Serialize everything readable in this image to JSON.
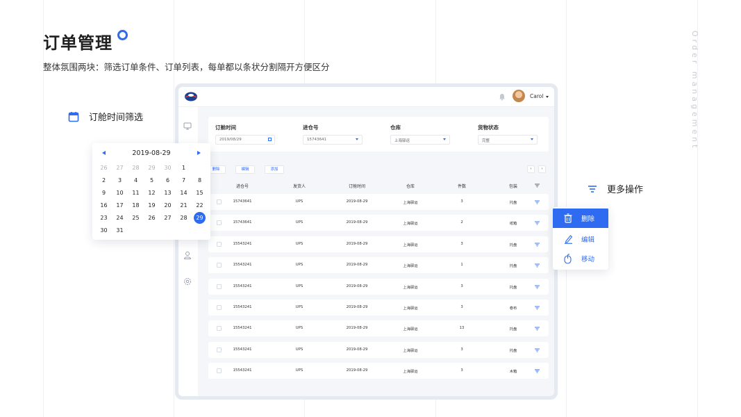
{
  "page": {
    "title": "订单管理",
    "subtitle": "整体氛围两块：筛选订单条件、订单列表，每单都以条状分割隔开方便区分",
    "vertical_label": "Order management"
  },
  "features": {
    "filter_label": "订舱时间筛选",
    "more_label": "更多操作"
  },
  "app": {
    "user": {
      "name": "Carol"
    },
    "filters": [
      {
        "label": "订舱时间",
        "value": "2019/08/29",
        "control": "date"
      },
      {
        "label": "进仓号",
        "value": "15743641",
        "control": "select"
      },
      {
        "label": "仓库",
        "value": "上海驿运",
        "control": "select"
      },
      {
        "label": "货物状态",
        "value": "完整",
        "control": "select"
      }
    ],
    "actions": {
      "delete": "删除",
      "edit": "编辑",
      "add": "添加"
    },
    "pager": {
      "prev": "‹",
      "next": "›"
    },
    "table": {
      "columns": [
        "进仓号",
        "发货人",
        "订舱时间",
        "仓库",
        "件数",
        "包装"
      ],
      "rows": [
        [
          "15743641",
          "UPS",
          "2019-08-29",
          "上海驿运",
          "3",
          "托盘"
        ],
        [
          "15743641",
          "UPS",
          "2019-08-29",
          "上海驿运",
          "2",
          "纸箱"
        ],
        [
          "15543241",
          "UPS",
          "2019-08-29",
          "上海驿运",
          "3",
          "托盘"
        ],
        [
          "15543241",
          "UPS",
          "2019-08-29",
          "上海驿运",
          "1",
          "托盘"
        ],
        [
          "15543241",
          "UPS",
          "2019-08-29",
          "上海驿运",
          "3",
          "托盘"
        ],
        [
          "15543241",
          "UPS",
          "2019-08-29",
          "上海驿运",
          "3",
          "卷布"
        ],
        [
          "15543241",
          "UPS",
          "2019-08-29",
          "上海驿运",
          "13",
          "托盘"
        ],
        [
          "15543241",
          "UPS",
          "2019-08-29",
          "上海驿运",
          "3",
          "托盘"
        ],
        [
          "15543241",
          "UPS",
          "2019-08-29",
          "上海驿运",
          "3",
          "木箱"
        ]
      ]
    }
  },
  "calendar": {
    "title": "2019-08-29",
    "days": [
      {
        "d": "26",
        "muted": true
      },
      {
        "d": "27",
        "muted": true
      },
      {
        "d": "28",
        "muted": true
      },
      {
        "d": "29",
        "muted": true
      },
      {
        "d": "30",
        "muted": true
      },
      {
        "d": "1"
      },
      {
        "d": "",
        "muted": true
      },
      {
        "d": "2"
      },
      {
        "d": "3"
      },
      {
        "d": "4"
      },
      {
        "d": "5"
      },
      {
        "d": "6"
      },
      {
        "d": "7"
      },
      {
        "d": "8"
      },
      {
        "d": "9"
      },
      {
        "d": "10"
      },
      {
        "d": "11"
      },
      {
        "d": "12"
      },
      {
        "d": "13"
      },
      {
        "d": "14"
      },
      {
        "d": "15"
      },
      {
        "d": "16"
      },
      {
        "d": "17"
      },
      {
        "d": "18"
      },
      {
        "d": "19"
      },
      {
        "d": "20"
      },
      {
        "d": "21"
      },
      {
        "d": "22"
      },
      {
        "d": "23"
      },
      {
        "d": "24"
      },
      {
        "d": "25"
      },
      {
        "d": "26"
      },
      {
        "d": "27"
      },
      {
        "d": "28"
      },
      {
        "d": "29",
        "selected": true
      },
      {
        "d": "30"
      },
      {
        "d": "31"
      }
    ]
  },
  "menu": {
    "items": [
      {
        "label": "删除",
        "icon": "trash-icon",
        "active": true
      },
      {
        "label": "编辑",
        "icon": "pen-icon",
        "active": false
      },
      {
        "label": "移动",
        "icon": "mouse-icon",
        "active": false
      }
    ]
  },
  "colors": {
    "accent": "#2f6bf0",
    "panel_bg": "#f4f6f9",
    "frame": "#e5e9f0"
  },
  "icons": {
    "calendar": "calendar-icon",
    "more": "filter-lines-icon",
    "bell": "bell-icon",
    "nav": [
      "monitor-icon",
      "user-icon",
      "settings-icon"
    ]
  }
}
